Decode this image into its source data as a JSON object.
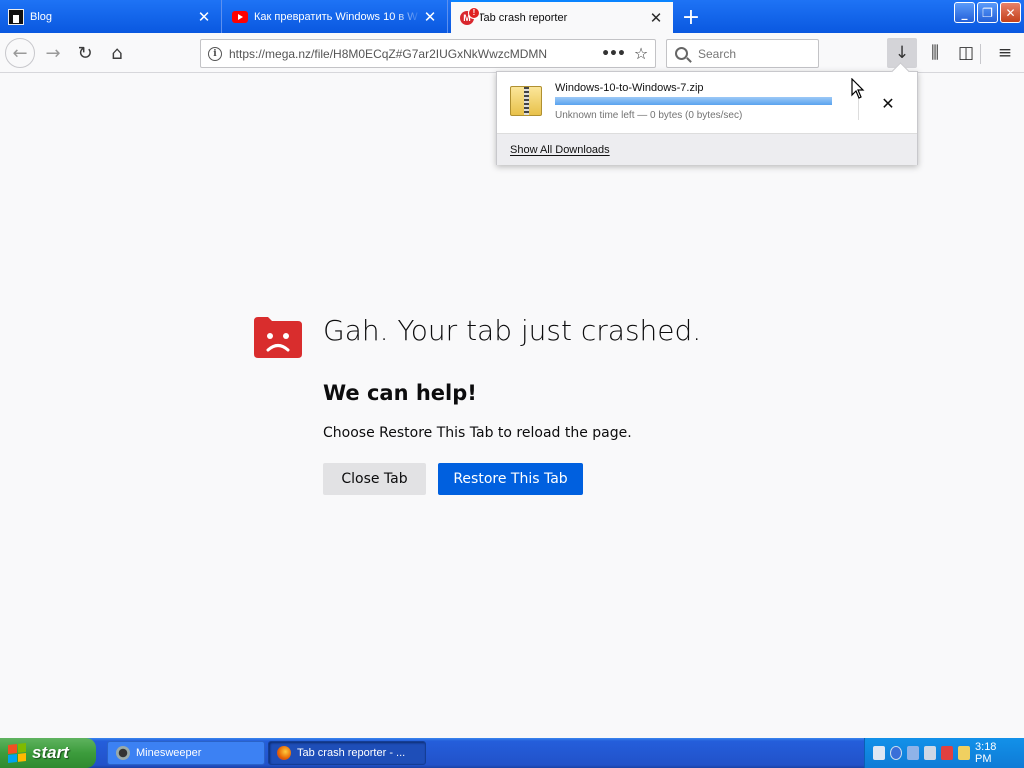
{
  "tabs": [
    {
      "label": "Blog",
      "state": "inactive",
      "favicon": "blog-favicon"
    },
    {
      "label": "Как превратить Windows 10 в W",
      "state": "inactive",
      "favicon": "youtube-favicon"
    },
    {
      "label": "Tab crash reporter",
      "state": "selected",
      "favicon": "mega-favicon"
    }
  ],
  "tab_close_glyph": "✕",
  "favicon_mega_letter": "M",
  "new_tab_glyph": "+",
  "window_buttons": {
    "minimize": "_",
    "maximize": "❐",
    "close": "✕"
  },
  "nav": {
    "back_glyph": "←",
    "forward_glyph": "→",
    "reload_glyph": "↻",
    "home_glyph": "⌂",
    "url_info_glyph": "i",
    "url": "https://mega.nz/file/H8M0ECqZ#G7ar2IUGxNkWwzcMDMN",
    "page_actions_glyph": "•••",
    "bookmark_glyph": "☆",
    "search_placeholder": "Search",
    "downloads_glyph": "↓",
    "library_glyph": "⫼",
    "sidebar_glyph": "◫",
    "menu_glyph": "≡"
  },
  "downloads_panel": {
    "filename": "Windows-10-to-Windows-7.zip",
    "progress_percent": 100,
    "status": "Unknown time left — 0 bytes (0 bytes/sec)",
    "cancel_glyph": "✕",
    "footer_label": "Show All Downloads"
  },
  "crash_page": {
    "title": "Gah. Your tab just crashed.",
    "subtitle": "We can help!",
    "description": "Choose Restore This Tab to reload the page.",
    "close_button": "Close Tab",
    "restore_button": "Restore This Tab",
    "icon_color": "#d92d2d"
  },
  "taskbar": {
    "start_label": "start",
    "tasks": [
      {
        "label": "Minesweeper",
        "active": false
      },
      {
        "label": "Tab crash reporter - ...",
        "active": true
      }
    ],
    "clock": "3:18 PM"
  },
  "colors": {
    "tabstrip": "#0a58e0",
    "accent_blue": "#0060df",
    "taskbar_blue": "#245edb",
    "start_green": "#3c9c3c"
  }
}
